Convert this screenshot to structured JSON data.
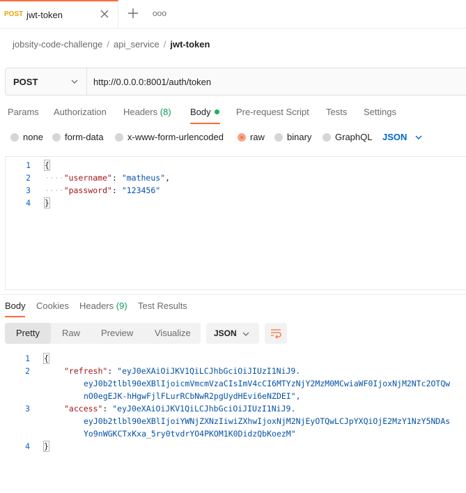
{
  "tab": {
    "method": "POST",
    "name": "jwt-token",
    "more": "ooo"
  },
  "breadcrumb": [
    "jobsity-code-challenge",
    "api_service",
    "jwt-token"
  ],
  "request": {
    "method": "POST",
    "url": "http://0.0.0.0:8001/auth/token"
  },
  "request_tabs": [
    {
      "label": "Params"
    },
    {
      "label": "Authorization"
    },
    {
      "label": "Headers",
      "count": "(8)"
    },
    {
      "label": "Body"
    },
    {
      "label": "Pre-request Script"
    },
    {
      "label": "Tests"
    },
    {
      "label": "Settings"
    }
  ],
  "body_types": [
    "none",
    "form-data",
    "x-www-form-urlencoded",
    "raw",
    "binary",
    "GraphQL"
  ],
  "body_language": "JSON",
  "request_body": {
    "line_numbers": [
      "1",
      "2",
      "3",
      "4"
    ],
    "open": "{",
    "close": "}",
    "lines": [
      {
        "key": "\"username\"",
        "value": "\"matheus\"",
        "trail": ","
      },
      {
        "key": "\"password\"",
        "value": "\"123456\"",
        "trail": ""
      }
    ]
  },
  "response_tabs": [
    {
      "label": "Body"
    },
    {
      "label": "Cookies"
    },
    {
      "label": "Headers",
      "count": "(9)"
    },
    {
      "label": "Test Results"
    }
  ],
  "view_modes": [
    "Pretty",
    "Raw",
    "Preview",
    "Visualize"
  ],
  "response_format": "JSON",
  "response_body": {
    "line_numbers": [
      "1",
      "2",
      "3",
      "4"
    ],
    "open": "{",
    "close": "}",
    "refresh": {
      "key": "\"refresh\"",
      "l1": "\"eyJ0eXAiOiJKV1QiLCJhbGciOiJIUzI1NiJ9.",
      "l2": "eyJ0b2tlbl90eXBlIjoicmVmcmVzaCIsImV4cCI6MTYzNjY2MzM0MCwiaWF0IjoxNjM2NTc2OTQw",
      "l3": "nO0egEJK-hHgwFjlFLurRCbNwR2pgUydHEvi6eNZDEI\","
    },
    "access": {
      "key": "\"access\"",
      "l1": "\"eyJ0eXAiOiJKV1QiLCJhbGciOiJIUzI1NiJ9.",
      "l2": "eyJ0b2tlbl90eXBlIjoiYWNjZXNzIiwiZXhwIjoxNjM2NjEyOTQwLCJpYXQiOjE2MzY1NzY5NDAs",
      "l3": "Yo9nWGKCTxKxa_5ry0tvdrYO4PKOM1K0DidzQbKoezM\""
    }
  },
  "colors": {
    "accent": "#ff6c37",
    "link": "#0265d2",
    "count": "#0f9d58",
    "json_key": "#a31515",
    "json_string": "#0451a5"
  }
}
